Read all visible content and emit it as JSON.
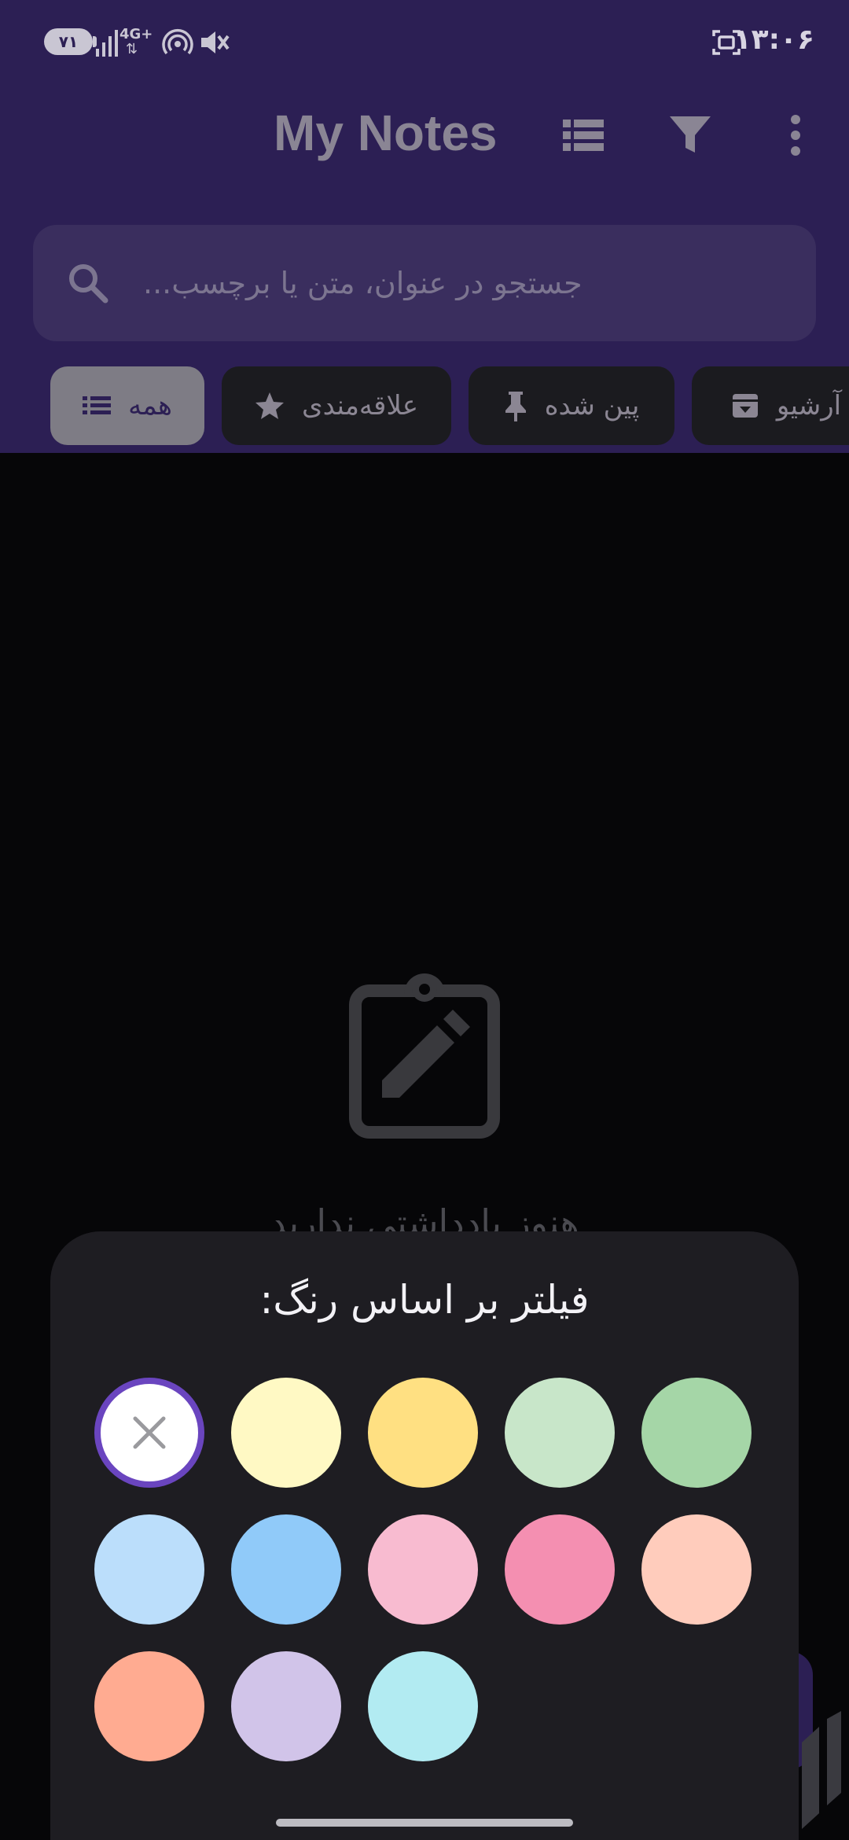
{
  "status_bar": {
    "battery": "۷۱",
    "network": "4G+",
    "time": "۱۳:۰۶"
  },
  "header": {
    "title": "My Notes",
    "icons": [
      "list-view-icon",
      "filter-icon",
      "more-vert-icon"
    ]
  },
  "search": {
    "placeholder": "جستجو در عنوان، متن یا برچسب..."
  },
  "chips": [
    {
      "label": "همه",
      "icon": "list-icon",
      "active": true
    },
    {
      "label": "علاقه‌مندی",
      "icon": "star-icon",
      "active": false
    },
    {
      "label": "پین شده",
      "icon": "pin-icon",
      "active": false
    },
    {
      "label": "آرشیو",
      "icon": "archive-icon",
      "active": false
    }
  ],
  "empty_state": {
    "icon": "clipboard-edit-icon",
    "text": "هنوز یادداشتی ندارید"
  },
  "color_filter": {
    "title": "فیلتر بر اساس رنگ:",
    "selected": "none",
    "colors": [
      "#FFF9C4",
      "#FFE082",
      "#C8E6C9",
      "#A5D6A7",
      "#BBDEFB",
      "#90CAF9",
      "#F8BBD0",
      "#F48FB1",
      "#FFCCBC",
      "#FFAB91",
      "#D1C4E9",
      "#B2EBF2"
    ]
  }
}
